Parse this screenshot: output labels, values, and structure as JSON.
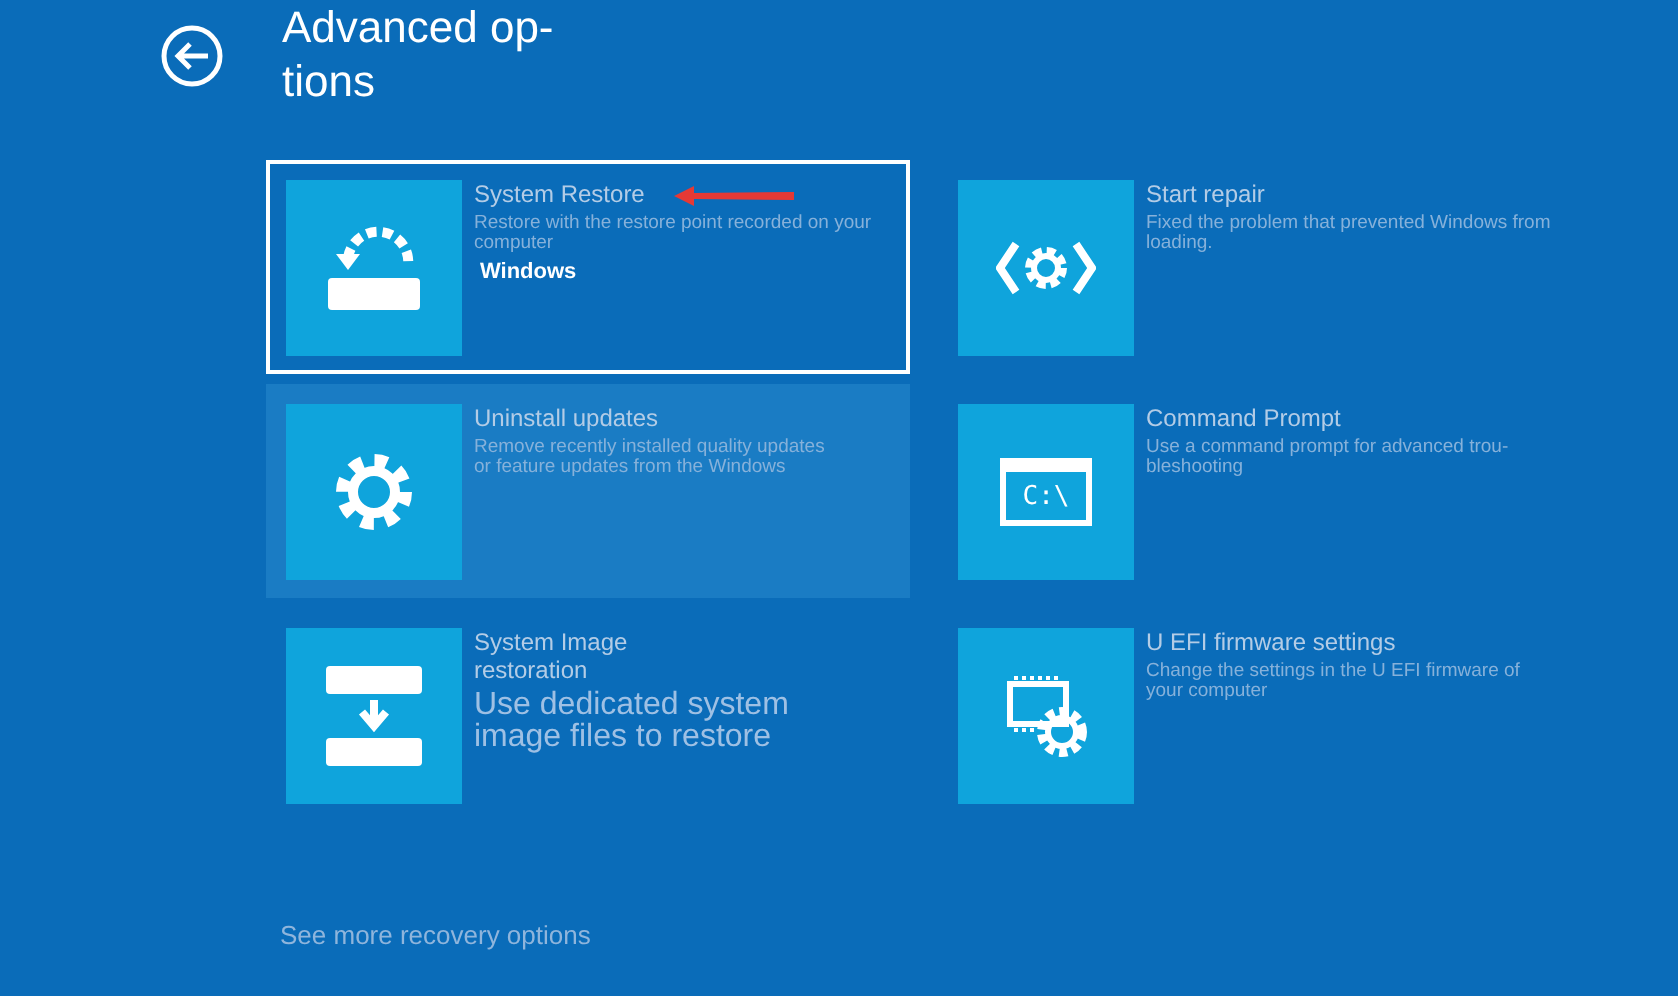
{
  "header": {
    "title": "Advanced op-\ntions"
  },
  "options": [
    {
      "kind": "restore",
      "title": "System Restore",
      "description": "Restore with the restore point recorded on your computer",
      "note": "Windows",
      "selected": true,
      "highlighted": false,
      "pointer_arrow": true
    },
    {
      "kind": "repair",
      "title": "Start repair",
      "description": "Fixed the problem that prevented Windows from loading.",
      "selected": false,
      "highlighted": false,
      "pointer_arrow": false
    },
    {
      "kind": "gear",
      "title": "Uninstall updates",
      "description": "Remove recently installed quality updates\nor feature updates from the Windows",
      "selected": false,
      "highlighted": true,
      "pointer_arrow": false
    },
    {
      "kind": "console",
      "icon_text": "C:\\",
      "title": "Command Prompt",
      "description": "Use a command prompt for advanced trou-\nbleshooting",
      "selected": false,
      "highlighted": false,
      "pointer_arrow": false
    },
    {
      "kind": "image",
      "title": "System Image\nrestoration",
      "description": "Use dedicated system\nimage files to restore",
      "selected": false,
      "highlighted": false,
      "pointer_arrow": false
    },
    {
      "kind": "firmware",
      "title": "U EFI firmware settings",
      "description": "Change the settings in the U EFI firmware of your computer",
      "selected": false,
      "highlighted": false,
      "pointer_arrow": false
    }
  ],
  "footer": {
    "link": "See more recovery options"
  }
}
